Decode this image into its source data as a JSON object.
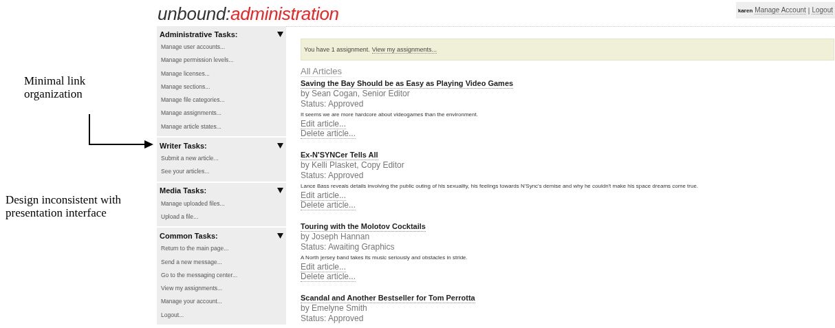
{
  "annotations": [
    {
      "text": "Minimal link organization"
    },
    {
      "text": "Design inconsistent with presentation interface"
    }
  ],
  "logo": {
    "prefix": "unbound:",
    "suffix": "administration"
  },
  "user_box": {
    "user": "karen",
    "links": [
      "Manage Account",
      "Logout"
    ],
    "separator": "|"
  },
  "sidebar": {
    "groups": [
      {
        "title": "Administrative Tasks:",
        "items": [
          "Manage user accounts...",
          "Manage permission levels...",
          "Manage licenses...",
          "Manage sections...",
          "Manage file categories...",
          "Manage assignments...",
          "Manage article states..."
        ]
      },
      {
        "title": "Writer Tasks:",
        "items": [
          "Submit a new article...",
          "See your articles..."
        ]
      },
      {
        "title": "Media Tasks:",
        "items": [
          "Manage uploaded files...",
          "Upload a file..."
        ]
      },
      {
        "title": "Common Tasks:",
        "items": [
          "Return to the main page...",
          "Send a new message...",
          "Go to the messaging center...",
          "View my assignments...",
          "Manage your account...",
          "Logout..."
        ]
      }
    ]
  },
  "notice": {
    "text": "You have 1 assignment.",
    "link": "View my assignments..."
  },
  "articles_heading": "All Articles",
  "articles": [
    {
      "title": "Saving the Bay Should be as Easy as Playing Video Games",
      "byline": "by Sean Cogan, Senior Editor",
      "status": "Status: Approved",
      "summary": "It seems we are more hardcore about videogames than the environment.",
      "actions": [
        "Edit article...",
        "Delete article..."
      ]
    },
    {
      "title": "Ex-N'SYNCer Tells All",
      "byline": "by Kelli Plasket, Copy Editor",
      "status": "Status: Approved",
      "summary": "Lance Bass reveals details involving the public outing of his sexuality, his feelings towards N'Sync's demise and why he couldn't make his space dreams come true.",
      "actions": [
        "Edit article...",
        "Delete article..."
      ]
    },
    {
      "title": "Touring with the Molotov Cocktails",
      "byline": "by Joseph Hannan",
      "status": "Status: Awaiting Graphics",
      "summary": "A North jersey band takes its music seriously and obstacles in stride.",
      "actions": [
        "Edit article...",
        "Delete article..."
      ]
    },
    {
      "title": "Scandal and Another Bestseller for Tom Perrotta",
      "byline": "by Emelyne Smith",
      "status": "Status: Approved"
    }
  ]
}
